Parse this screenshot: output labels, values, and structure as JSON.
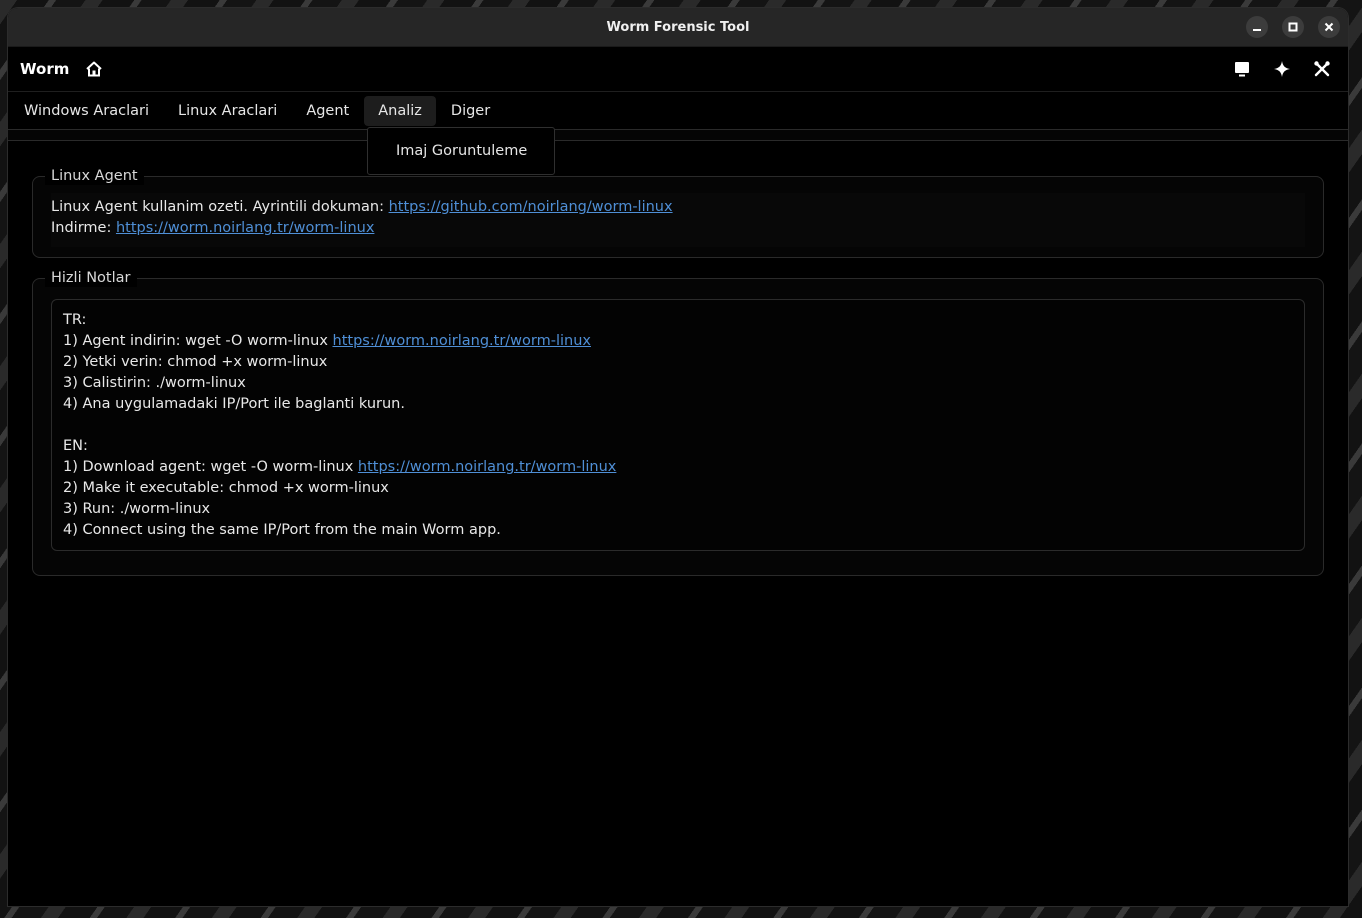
{
  "window": {
    "title": "Worm Forensic Tool"
  },
  "appbar": {
    "name": "Worm",
    "icons": [
      "home-icon",
      "monitor-icon",
      "sparkle-icon",
      "tools-icon"
    ]
  },
  "menu": {
    "items": [
      {
        "label": "Windows Araclari"
      },
      {
        "label": "Linux Araclari"
      },
      {
        "label": "Agent"
      },
      {
        "label": "Analiz"
      },
      {
        "label": "Diger"
      }
    ],
    "active": "Analiz",
    "dropdown": {
      "items": [
        {
          "label": "Imaj Goruntuleme"
        }
      ]
    }
  },
  "linux_agent": {
    "title": "Linux Agent",
    "line1_text": "Linux Agent kullanim ozeti. Ayrintili dokuman: ",
    "line1_link": "https://github.com/noirlang/worm-linux",
    "line2_text": "Indirme: ",
    "line2_link": "https://worm.noirlang.tr/worm-linux"
  },
  "notes": {
    "title": "Hizli Notlar",
    "tr_header": "TR:",
    "tr1_text": "1) Agent indirin: wget -O worm-linux ",
    "tr1_link": "https://worm.noirlang.tr/worm-linux",
    "tr2": "2) Yetki verin: chmod +x worm-linux",
    "tr3": "3) Calistirin: ./worm-linux",
    "tr4": "4) Ana uygulamadaki IP/Port ile baglanti kurun.",
    "en_header": "EN:",
    "en1_text": "1) Download agent: wget -O worm-linux ",
    "en1_link": "https://worm.noirlang.tr/worm-linux",
    "en2": "2) Make it executable: chmod +x worm-linux",
    "en3": "3) Run: ./worm-linux",
    "en4": "4) Connect using the same IP/Port from the main Worm app."
  },
  "colors": {
    "link": "#4f8fd6",
    "background": "#000000",
    "titlebar": "#262626"
  }
}
